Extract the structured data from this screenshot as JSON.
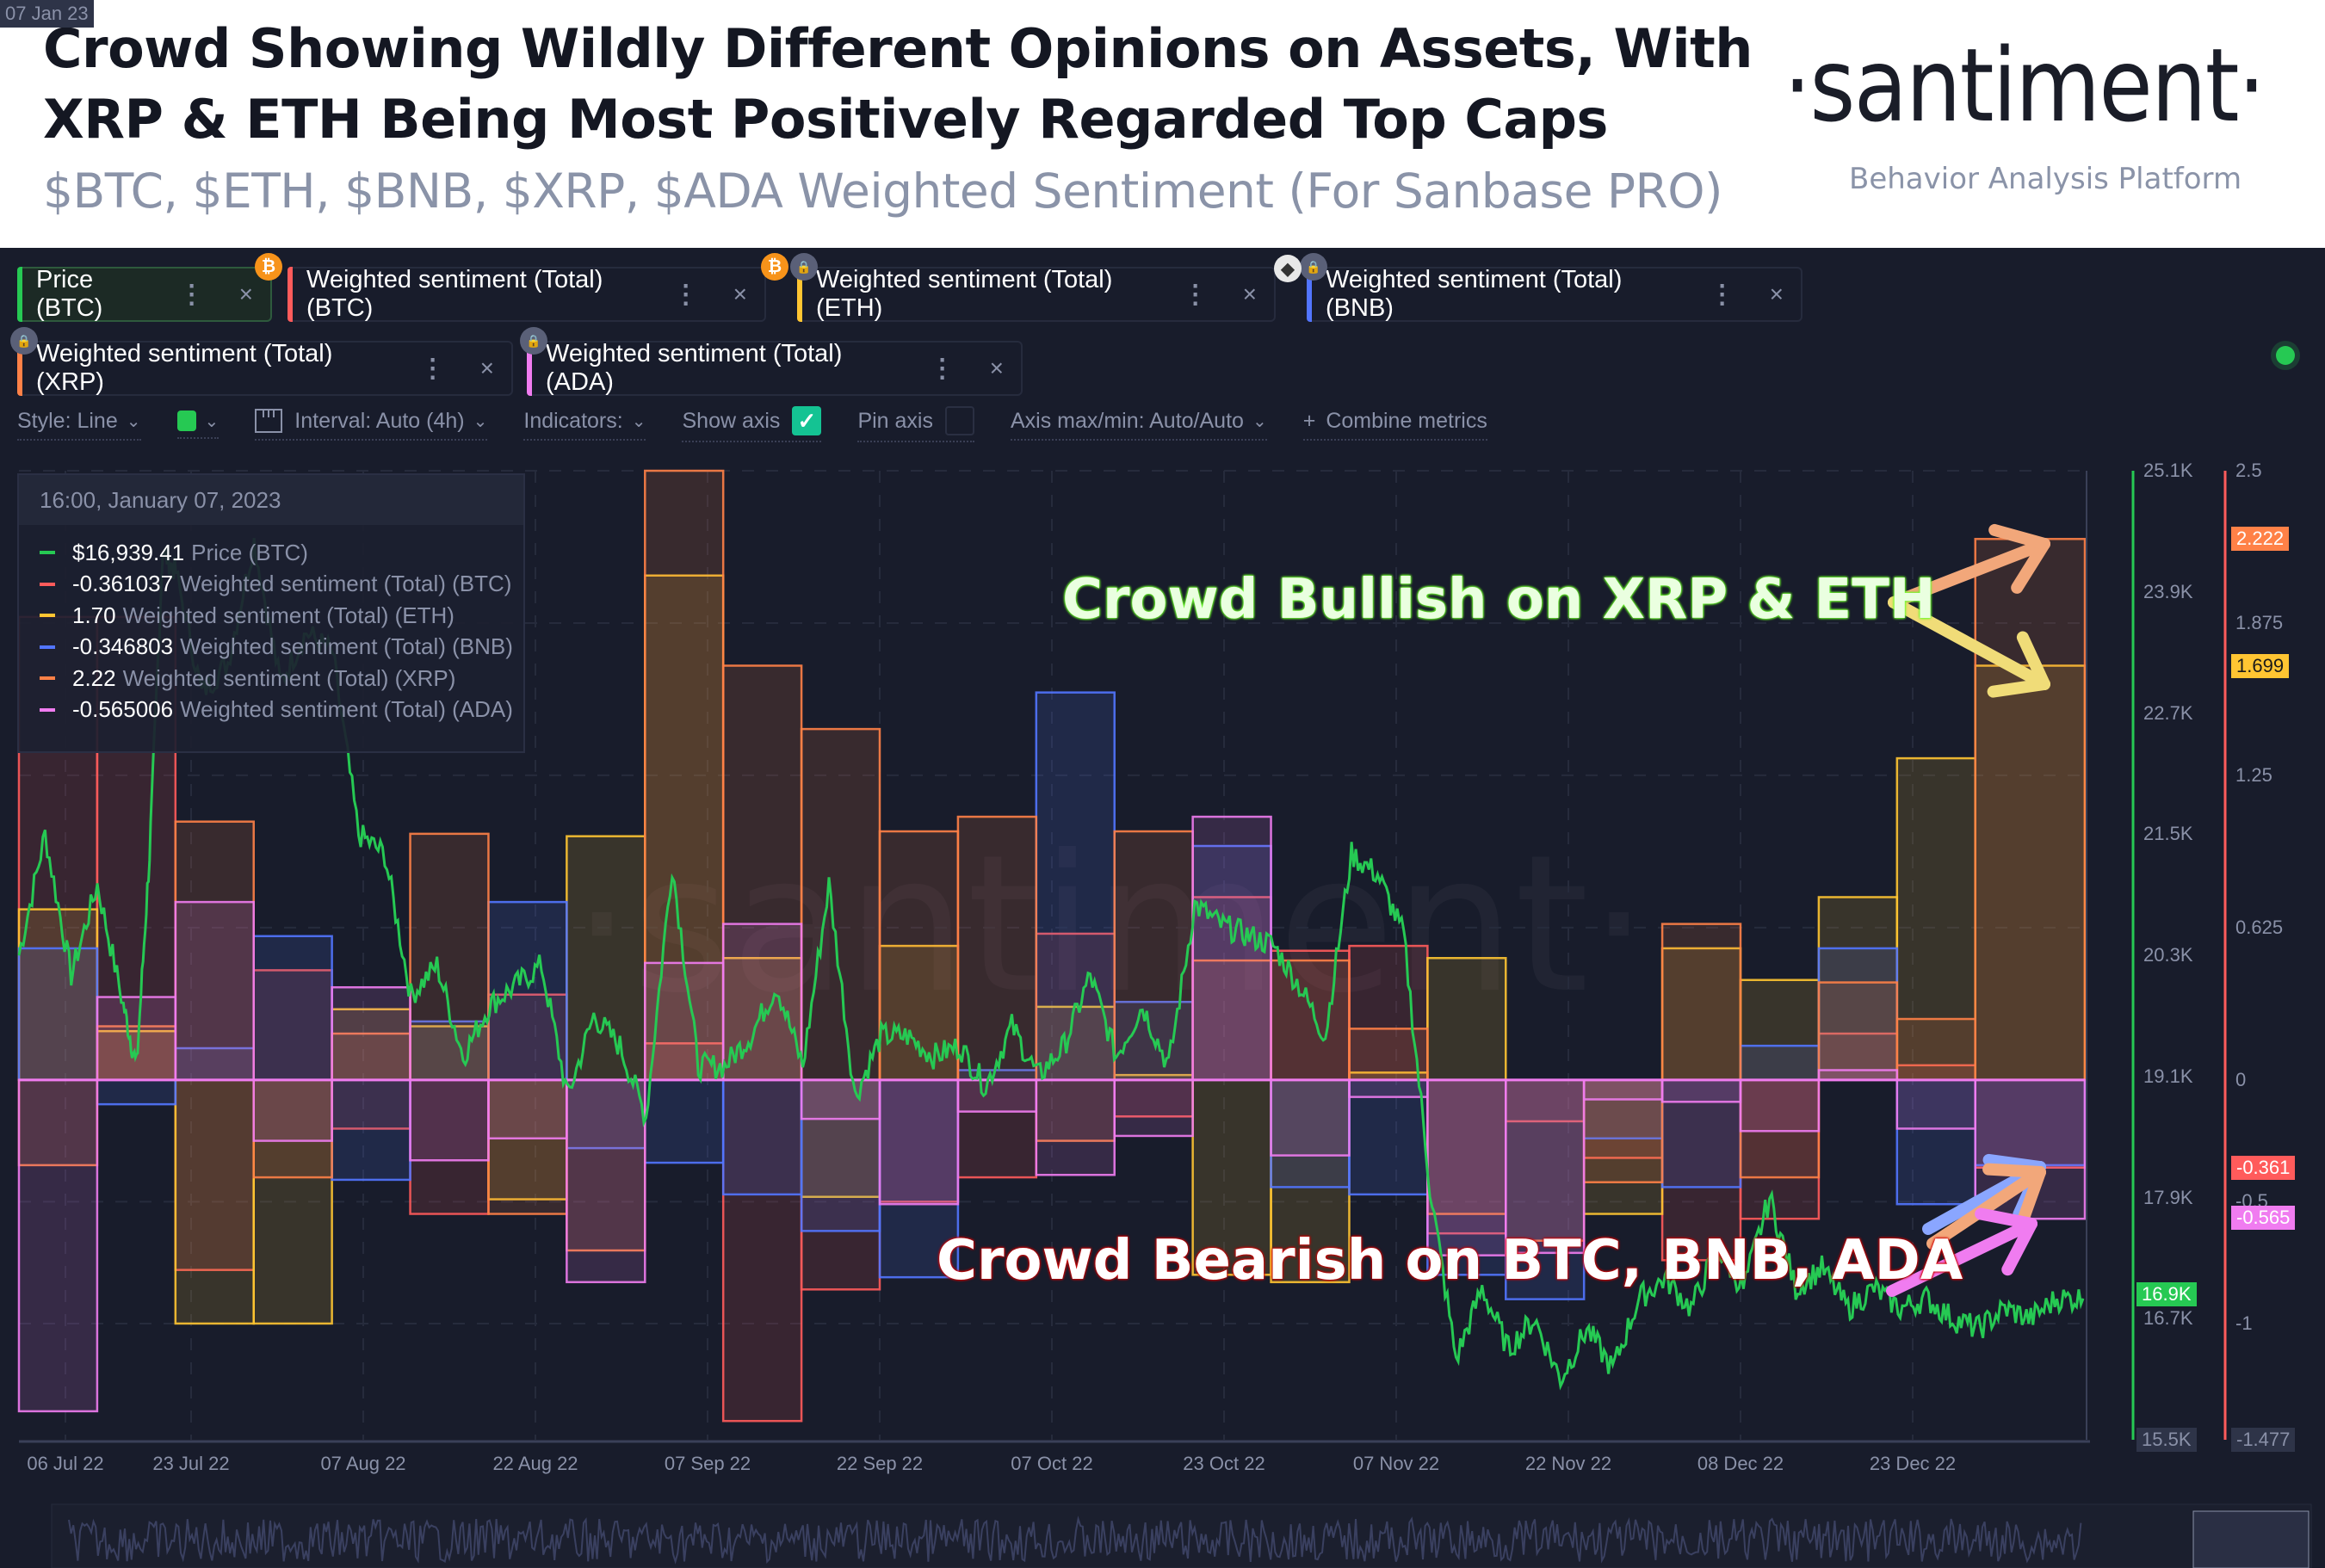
{
  "header": {
    "title_line1": "Crowd Showing Wildly Different Opinions on Assets, With",
    "title_line2": "XRP & ETH Being Most Positively Regarded Top Caps",
    "subtitle": "$BTC, $ETH, $BNB, $XRP, $ADA Weighted Sentiment (For Sanbase PRO)",
    "logo": "·santiment·",
    "logo_tagline": "Behavior Analysis Platform"
  },
  "metrics": [
    {
      "label": "Price (BTC)",
      "color": "#26c953",
      "badge": "btc-icon",
      "active": true
    },
    {
      "label": "Weighted sentiment (Total) (BTC)",
      "color": "#ff5b5b",
      "badge": "btc-icon"
    },
    {
      "label": "Weighted sentiment (Total) (ETH)",
      "color": "#ffc532",
      "badge": "lock-icon"
    },
    {
      "label": "Weighted sentiment (Total) (BNB)",
      "color": "#5275ff",
      "badge": "lock-icon"
    },
    {
      "label": "Weighted sentiment (Total) (XRP)",
      "color": "#ff8147",
      "badge": "lock-icon"
    },
    {
      "label": "Weighted sentiment (Total) (ADA)",
      "color": "#f07cf0",
      "badge": "lock-icon"
    }
  ],
  "metric_menu_glyph": "⋮",
  "metric_close_glyph": "×",
  "toolbar": {
    "style": "Style: Line",
    "interval": "Interval: Auto (4h)",
    "indicators": "Indicators:",
    "show_axis": "Show axis",
    "show_axis_checked": true,
    "pin_axis": "Pin axis",
    "pin_axis_checked": false,
    "axis_maxmin": "Axis max/min: Auto/Auto",
    "combine": "Combine metrics",
    "plus": "+",
    "chev": "⌄",
    "check": "✓"
  },
  "tooltip": {
    "datetime": "16:00, January 07, 2023",
    "rows": [
      {
        "value": "$16,939.41",
        "label": "Price (BTC)",
        "color": "#26c953"
      },
      {
        "value": "-0.361037",
        "label": "Weighted sentiment (Total) (BTC)",
        "color": "#ff5b5b"
      },
      {
        "value": "1.70",
        "label": "Weighted sentiment (Total) (ETH)",
        "color": "#ffc532"
      },
      {
        "value": "-0.346803",
        "label": "Weighted sentiment (Total) (BNB)",
        "color": "#5275ff"
      },
      {
        "value": "2.22",
        "label": "Weighted sentiment (Total) (XRP)",
        "color": "#ff8147"
      },
      {
        "value": "-0.565006",
        "label": "Weighted sentiment (Total) (ADA)",
        "color": "#f07cf0"
      }
    ]
  },
  "annotations": {
    "bullish": "Crowd Bullish on XRP & ETH",
    "bearish": "Crowd Bearish on BTC, BNB, ADA"
  },
  "watermark": "·santiment·",
  "chart_data": {
    "type": "line",
    "title": "$BTC, $ETH, $BNB, $XRP, $ADA Weighted Sentiment",
    "x_tick_labels": [
      "06 Jul 22",
      "23 Jul 22",
      "07 Aug 22",
      "22 Aug 22",
      "07 Sep 22",
      "22 Sep 22",
      "07 Oct 22",
      "23 Oct 22",
      "07 Nov 22",
      "22 Nov 22",
      "08 Dec 22",
      "23 Dec 22"
    ],
    "x_cursor_label": "07 Jan 23",
    "x_range": [
      "2022-07-04",
      "2023-01-08"
    ],
    "price_axis": {
      "ticks": [
        "25.1K",
        "23.9K",
        "22.7K",
        "21.5K",
        "20.3K",
        "19.1K",
        "17.9K",
        "16.7K"
      ],
      "min_label": "15.5K",
      "range": [
        15500,
        25100
      ],
      "current_label": "16.9K"
    },
    "sentiment_axis": {
      "ticks": [
        "2.5",
        "1.875",
        "1.25",
        "0.625",
        "0",
        "-0.5",
        "-1"
      ],
      "min_label": "-1.477",
      "range": [
        -1.477,
        2.5
      ]
    },
    "current_value_labels": [
      {
        "series": "XRP",
        "label": "2.222",
        "color": "#ff8147"
      },
      {
        "series": "ETH",
        "label": "1.699",
        "color": "#ffc532"
      },
      {
        "series": "BTC",
        "label": "-0.361",
        "color": "#ff5b5b"
      },
      {
        "series": "ADA",
        "label": "-0.565",
        "color": "#f07cf0"
      }
    ],
    "weeks": 26,
    "sentiment_series": [
      {
        "name": "Weighted sentiment (Total) (BTC)",
        "color": "#ff5b5b",
        "values": [
          1.9,
          1.9,
          -0.78,
          0.45,
          -0.2,
          -0.55,
          0.35,
          0.0,
          0.15,
          -1.4,
          -0.86,
          -0.5,
          -0.4,
          0.6,
          -0.15,
          0.75,
          0.53,
          0.55,
          -0.63,
          -0.17,
          -0.32,
          -0.74,
          -0.57,
          0.19,
          0.06,
          -0.36
        ]
      },
      {
        "name": "Weighted sentiment (Total) (ETH)",
        "color": "#ffc532",
        "values": [
          0.7,
          0.2,
          -1.0,
          -1.0,
          0.29,
          0.22,
          -0.49,
          1.0,
          2.07,
          0.5,
          -0.48,
          0.55,
          0.0,
          0.3,
          0.02,
          -0.8,
          -0.83,
          0.03,
          0.5,
          0.0,
          -0.55,
          0.54,
          0.41,
          0.75,
          1.32,
          1.7
        ]
      },
      {
        "name": "Weighted sentiment (Total) (BNB)",
        "color": "#5275ff",
        "values": [
          0.54,
          -0.1,
          0.13,
          0.59,
          -0.41,
          0.24,
          0.73,
          -0.28,
          -0.34,
          -0.47,
          -0.62,
          -0.81,
          0.04,
          1.59,
          0.32,
          0.96,
          -0.44,
          -0.47,
          -0.8,
          -0.9,
          -0.24,
          -0.44,
          0.14,
          0.54,
          -0.51,
          -0.35
        ]
      },
      {
        "name": "Weighted sentiment (Total) (XRP)",
        "color": "#ff8147",
        "values": [
          -0.35,
          0.22,
          1.06,
          -0.4,
          0.19,
          1.01,
          -0.55,
          -0.7,
          2.5,
          1.7,
          1.44,
          1.02,
          1.08,
          -0.25,
          1.02,
          0.49,
          0.49,
          0.21,
          -0.55,
          -0.66,
          -0.42,
          0.64,
          -0.4,
          0.4,
          0.25,
          2.22
        ]
      },
      {
        "name": "Weighted sentiment (Total) (ADA)",
        "color": "#f07cf0",
        "values": [
          -1.36,
          0.34,
          0.73,
          -0.25,
          0.38,
          -0.33,
          -0.24,
          -0.83,
          0.48,
          0.64,
          -0.16,
          -0.51,
          -0.13,
          -0.39,
          -0.23,
          1.08,
          -0.31,
          -0.07,
          -0.72,
          -0.71,
          -0.08,
          -0.09,
          -0.21,
          0.04,
          -0.2,
          -0.57
        ]
      }
    ],
    "price_series": {
      "name": "Price (BTC)",
      "color": "#26c953",
      "points": [
        [
          0,
          20300
        ],
        [
          1,
          21500
        ],
        [
          2,
          20100
        ],
        [
          3,
          21000
        ],
        [
          4,
          19800
        ],
        [
          4.5,
          19200
        ],
        [
          5,
          21300
        ],
        [
          5.5,
          24300
        ],
        [
          6,
          24100
        ],
        [
          7,
          22900
        ],
        [
          8,
          23200
        ],
        [
          9,
          24400
        ],
        [
          10,
          23000
        ],
        [
          11,
          23500
        ],
        [
          12,
          23300
        ],
        [
          13,
          21500
        ],
        [
          14,
          21300
        ],
        [
          15,
          19900
        ],
        [
          16,
          20200
        ],
        [
          17,
          19300
        ],
        [
          18,
          19800
        ],
        [
          19,
          20000
        ],
        [
          20,
          20200
        ],
        [
          21,
          18900
        ],
        [
          22,
          19700
        ],
        [
          23,
          19400
        ],
        [
          24,
          18700
        ],
        [
          25,
          21200
        ],
        [
          26,
          19200
        ],
        [
          27,
          19200
        ],
        [
          28,
          19500
        ],
        [
          29,
          20000
        ],
        [
          30,
          19200
        ],
        [
          31,
          21000
        ],
        [
          32,
          18900
        ],
        [
          33,
          19500
        ],
        [
          34,
          19500
        ],
        [
          35,
          19300
        ],
        [
          36,
          19400
        ],
        [
          37,
          19000
        ],
        [
          38,
          19600
        ],
        [
          39,
          19100
        ],
        [
          40,
          19400
        ],
        [
          41,
          20100
        ],
        [
          42,
          19300
        ],
        [
          43,
          19800
        ],
        [
          44,
          19200
        ],
        [
          45,
          20800
        ],
        [
          46,
          20600
        ],
        [
          47,
          20500
        ],
        [
          48,
          20400
        ],
        [
          49,
          20000
        ],
        [
          50,
          19500
        ],
        [
          51,
          21300
        ],
        [
          52,
          21100
        ],
        [
          53,
          20500
        ],
        [
          54,
          18000
        ],
        [
          55,
          16300
        ],
        [
          56,
          17000
        ],
        [
          57,
          16400
        ],
        [
          58,
          16700
        ],
        [
          59,
          16100
        ],
        [
          60,
          16600
        ],
        [
          61,
          16200
        ],
        [
          62,
          16900
        ],
        [
          63,
          17100
        ],
        [
          64,
          16800
        ],
        [
          65,
          17400
        ],
        [
          66,
          17000
        ],
        [
          67,
          17900
        ],
        [
          68,
          17000
        ],
        [
          69,
          17200
        ],
        [
          70,
          16800
        ],
        [
          71,
          17000
        ],
        [
          72,
          16800
        ],
        [
          73,
          16900
        ],
        [
          74,
          16700
        ],
        [
          75,
          16600
        ],
        [
          76,
          16800
        ],
        [
          77,
          16700
        ],
        [
          78,
          16900
        ],
        [
          79,
          16900
        ]
      ],
      "x_domain_points": 79
    }
  }
}
